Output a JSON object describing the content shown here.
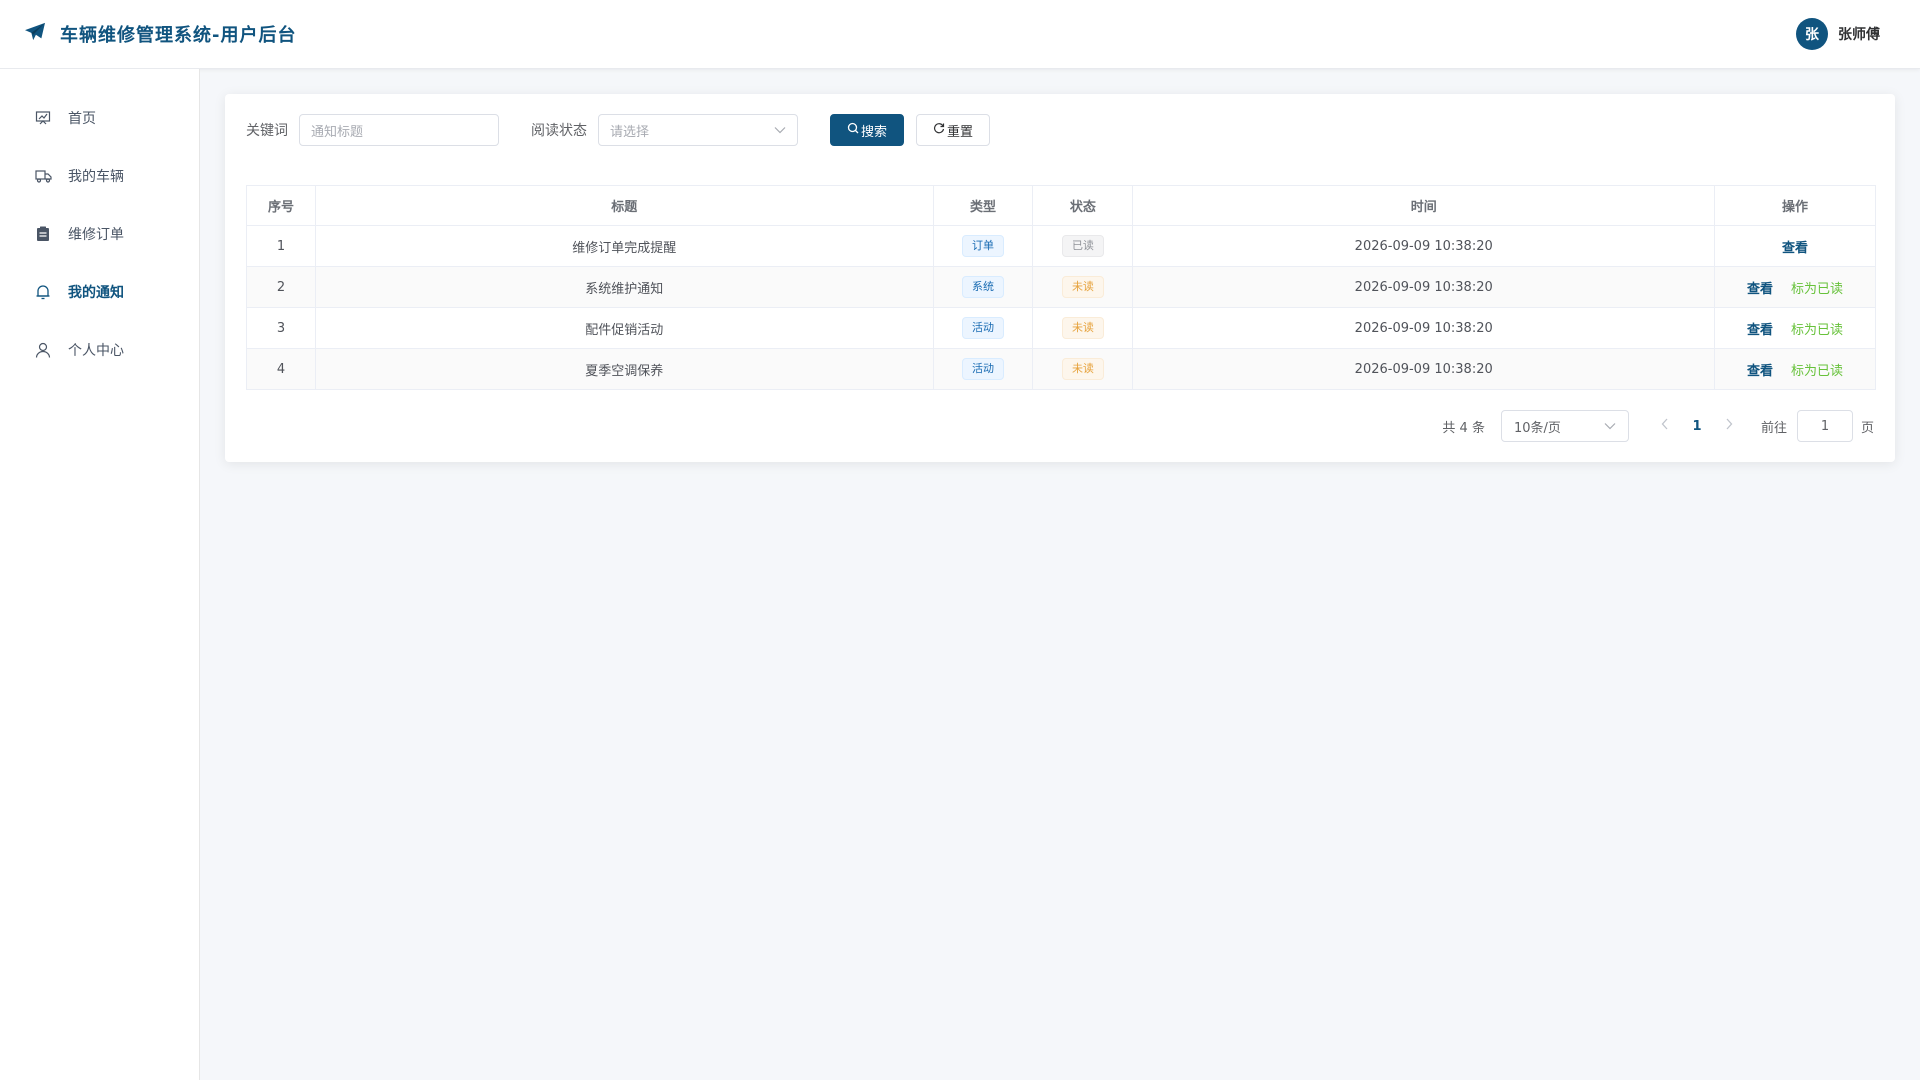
{
  "header": {
    "title": "车辆维修管理系统-用户后台",
    "user_avatar": "张",
    "user_name": "张师傅"
  },
  "sidebar": {
    "items": [
      {
        "label": "首页",
        "icon": "dashboard-icon"
      },
      {
        "label": "我的车辆",
        "icon": "truck-icon"
      },
      {
        "label": "维修订单",
        "icon": "clipboard-icon"
      },
      {
        "label": "我的通知",
        "icon": "bell-icon",
        "active": true
      },
      {
        "label": "个人中心",
        "icon": "user-icon"
      }
    ]
  },
  "search": {
    "keyword_label": "关键词",
    "keyword_placeholder": "通知标题",
    "status_label": "阅读状态",
    "status_placeholder": "请选择",
    "search_button": "搜索",
    "reset_button": "重置"
  },
  "table": {
    "headers": [
      "序号",
      "标题",
      "类型",
      "状态",
      "时间",
      "操作"
    ],
    "rows": [
      {
        "index": "1",
        "title": "维修订单完成提醒",
        "type": "订单",
        "status": "已读",
        "time": "2026-09-09 10:38:20",
        "view": "查看",
        "mark": ""
      },
      {
        "index": "2",
        "title": "系统维护通知",
        "type": "系统",
        "status": "未读",
        "time": "2026-09-09 10:38:20",
        "view": "查看",
        "mark": "标为已读"
      },
      {
        "index": "3",
        "title": "配件促销活动",
        "type": "活动",
        "status": "未读",
        "time": "2026-09-09 10:38:20",
        "view": "查看",
        "mark": "标为已读"
      },
      {
        "index": "4",
        "title": "夏季空调保养",
        "type": "活动",
        "status": "未读",
        "time": "2026-09-09 10:38:20",
        "view": "查看",
        "mark": "标为已读"
      }
    ]
  },
  "pagination": {
    "total": "共 4 条",
    "page_size": "10条/页",
    "current": "1",
    "goto_label": "前往",
    "goto_value": "1",
    "page_unit": "页"
  },
  "colors": {
    "primary": "#10547f",
    "success": "#67c23a",
    "warning": "#e6a23c"
  }
}
